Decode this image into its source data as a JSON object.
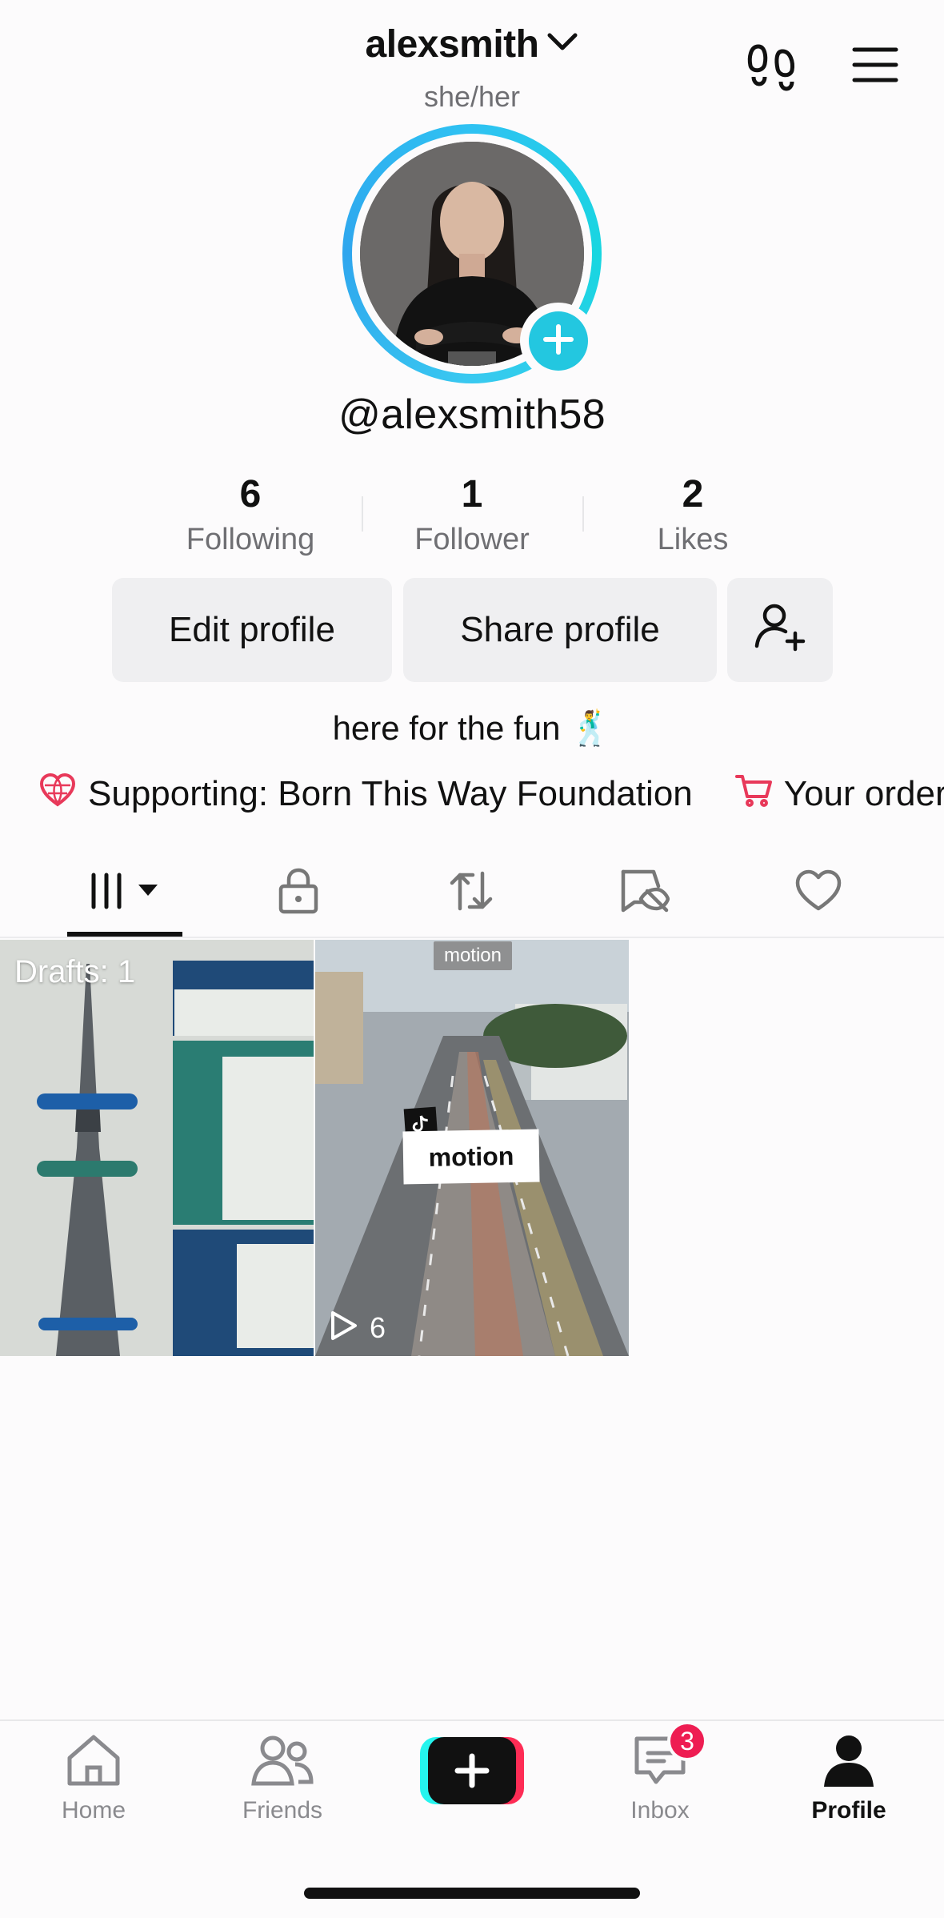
{
  "header": {
    "username": "alexsmith",
    "pronouns": "she/her"
  },
  "profile": {
    "handle": "@alexsmith58",
    "bio": "here for the fun 🕺"
  },
  "stats": [
    {
      "value": "6",
      "label": "Following"
    },
    {
      "value": "1",
      "label": "Follower"
    },
    {
      "value": "2",
      "label": "Likes"
    }
  ],
  "actions": {
    "edit_profile": "Edit profile",
    "share_profile": "Share profile"
  },
  "links": {
    "supporting": "Supporting: Born This Way Foundation",
    "orders": "Your orders"
  },
  "tabs": [
    "videos-grid",
    "private",
    "reposts",
    "hidden",
    "liked"
  ],
  "grid": {
    "drafts_label": "Drafts: 1",
    "video_tag": "motion",
    "video_caption": "motion",
    "video_plays": "6"
  },
  "nav": {
    "home": "Home",
    "friends": "Friends",
    "inbox": "Inbox",
    "inbox_badge": "3",
    "profile": "Profile"
  },
  "colors": {
    "accent_cyan": "#23c7e0",
    "accent_red": "#ee1d52",
    "support_icon": "#e8395a"
  }
}
